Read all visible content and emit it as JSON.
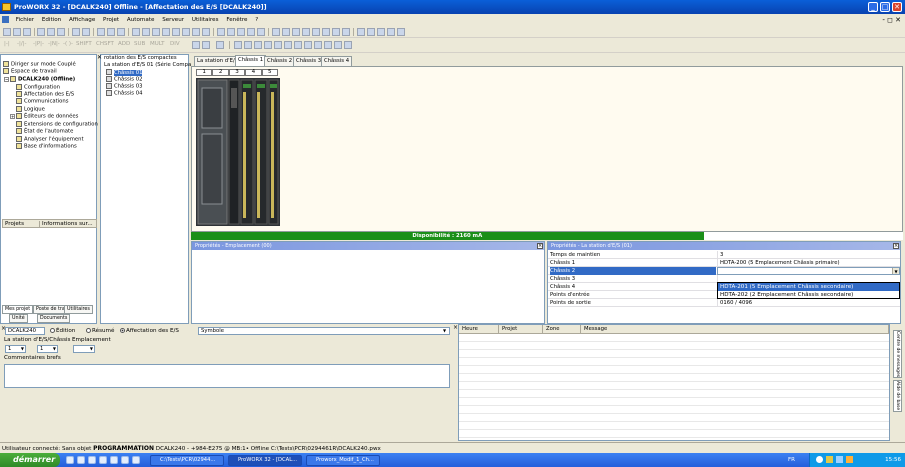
{
  "window": {
    "title": "ProWORX 32 - [DCALK240] Offline - [Affectation des E/S [DCALK240]]",
    "btn_min": "_",
    "btn_max": "□",
    "btn_close": "✕"
  },
  "menubar": {
    "items": [
      "Fichier",
      "Edition",
      "Affichage",
      "Projet",
      "Automate",
      "Serveur",
      "Utilitaires",
      "Fenêtre",
      "?"
    ],
    "mdi": "- ◻ ✕"
  },
  "toolbar2": {
    "disabled_labels": [
      "|-|",
      "-|/|-",
      "-|P|-",
      "-|N|-",
      "-( )-",
      "SHIFT",
      "CHSFT",
      "ADD",
      "SUB",
      "MULT",
      "DIV"
    ]
  },
  "tree": {
    "items": [
      {
        "label": "Diriger sur mode Couplé"
      },
      {
        "label": "Espace de travail"
      },
      {
        "label": "DCALK240  (Offline)"
      },
      {
        "label": "Configuration"
      },
      {
        "label": "Affectation des E/S"
      },
      {
        "label": "Communications"
      },
      {
        "label": "Logique"
      },
      {
        "label": "Éditeurs de données"
      },
      {
        "label": "Extensions de configuration"
      },
      {
        "label": "État de l'automate"
      },
      {
        "label": "Analyser l'équipement"
      },
      {
        "label": "Base d'informations"
      }
    ]
  },
  "project_table": {
    "headers": [
      "Projets",
      "Informations sur..."
    ]
  },
  "left_tabs": [
    "Mes projet",
    "Poste de trav",
    "Utilitaires",
    "Unité",
    "Documents"
  ],
  "mid_tree": {
    "items": [
      "rotation des E/S compactes",
      "La station d'E/S 01 (Série Compact T",
      "Châssis 01",
      "Châssis 02",
      "Châssis 03",
      "Châssis 04"
    ]
  },
  "tabs": [
    "La station d'E/S",
    "Châssis 1",
    "Châssis 2",
    "Châssis 3",
    "Châssis 4"
  ],
  "slots": [
    "1",
    "2",
    "3",
    "4",
    "5"
  ],
  "availability": {
    "text": "Disponibilité : 2160 mA",
    "fraction": 0.72
  },
  "panels": {
    "placement_title": "Propriétés - Emplacement (00)",
    "station_title": "Propriétés - La station d'E/S (01)"
  },
  "properties": [
    {
      "key": "Temps de maintien",
      "value": "3"
    },
    {
      "key": "Châssis 1",
      "value": "HDTA-200  (5 Emplacement Châssis primaire)"
    },
    {
      "key": "Châssis 2",
      "value": ""
    },
    {
      "key": "Châssis 3",
      "value": ""
    },
    {
      "key": "Châssis 4",
      "value": ""
    },
    {
      "key": "Points d'entrée",
      "value": ""
    },
    {
      "key": "Points de sortie",
      "value": "0160 / 4096"
    }
  ],
  "dropdown_options": [
    "HDTA-201  (5 Emplacement Châssis secondaire)",
    "HDTA-202  (2 Emplacement Châssis secondaire)"
  ],
  "bottom_left": {
    "device": "DCALK240",
    "radio_labels": [
      "Édition",
      "Résumé",
      "Affectation des E/S"
    ],
    "symbol_label": "Symbole",
    "station_label": "La station d'E/S/Châssis",
    "slot_label": "Emplacement",
    "station_value": "1",
    "chassis_value": "1",
    "slot_value": "",
    "comment_label": "Commentaires brefs"
  },
  "messages": {
    "headers": [
      "Heure",
      "Projet",
      "Zone",
      "Message"
    ],
    "side_tabs": [
      "Centre de messages",
      "Aide de base"
    ]
  },
  "statusbar": {
    "prefix": "Utilisateur connecté: Sans objet ",
    "mode": "PROGRAMMATION",
    "details": " DCALK240 - +984-E275 @ MB:1• Offline  C:\\Tests\\PCR\\0294461R\\DCALK240.pwx"
  },
  "taskbar": {
    "start": "démarrer",
    "tasks": [
      "C:\\Tests\\PCR\\02944...",
      "ProWORX 32 - [DCAL...",
      "Proworx_Modif_1_Ch..."
    ],
    "lang": "FR",
    "clock": "15:56"
  },
  "colors": {
    "titlebar": "#0a5fd8",
    "availability": "#1a8f18",
    "panel_header": "#7a96df",
    "selected_row": "#316ac5"
  }
}
